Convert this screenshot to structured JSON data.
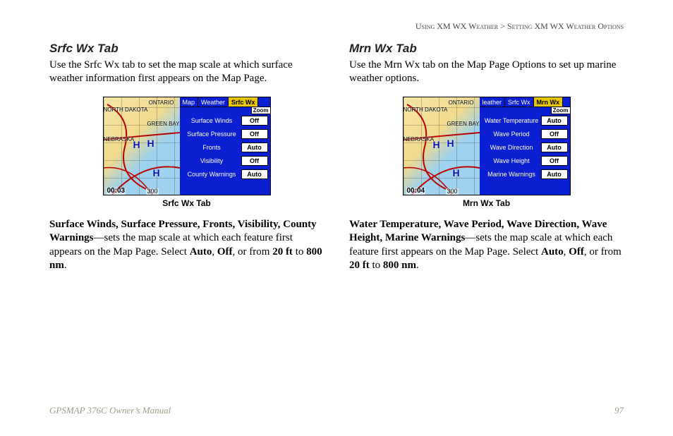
{
  "breadcrumb": {
    "section": "Using XM WX Weather",
    "sep": " > ",
    "sub": "Setting XM WX Weather Options"
  },
  "left": {
    "heading": "Srfc Wx Tab",
    "intro": "Use the Srfc Wx tab to set the map scale at which surface weather information first appears on the Map Page.",
    "device": {
      "tabs": [
        "Map",
        "Weather",
        "Srfc Wx"
      ],
      "activeTabIndex": 2,
      "zoomLabel": "Zoom",
      "rows": [
        {
          "label": "Surface Winds",
          "value": "Off"
        },
        {
          "label": "Surface Pressure",
          "value": "Off"
        },
        {
          "label": "Fronts",
          "value": "Auto"
        },
        {
          "label": "Visibility",
          "value": "Off"
        },
        {
          "label": "County Warnings",
          "value": "Auto"
        }
      ],
      "clock": "00:03",
      "scale": "300",
      "states": [
        "ONTARIO",
        "GREEN BAY",
        "NEBRASKA",
        "NORTH DAKOTA"
      ]
    },
    "caption": "Srfc Wx Tab",
    "desc": {
      "bold_list": "Surface Winds, Surface Pressure, Fronts, Visibility, County Warnings",
      "mid": "—sets the map scale at which each feature first appears on the Map Page. Select ",
      "opts": {
        "a": "Auto",
        "b": "Off",
        "c": "20 ft",
        "d": "800 nm"
      }
    }
  },
  "right": {
    "heading": "Mrn Wx Tab",
    "intro": "Use the Mrn Wx tab on the Map Page Options to set up marine weather options.",
    "device": {
      "tabs": [
        "leather",
        "Srfc Wx",
        "Mrn Wx"
      ],
      "activeTabIndex": 2,
      "zoomLabel": "Zoom",
      "rows": [
        {
          "label": "Water Temperature",
          "value": "Auto"
        },
        {
          "label": "Wave Period",
          "value": "Off"
        },
        {
          "label": "Wave Direction",
          "value": "Auto"
        },
        {
          "label": "Wave Height",
          "value": "Off"
        },
        {
          "label": "Marine Warnings",
          "value": "Auto"
        }
      ],
      "clock": "00:04",
      "scale": "300",
      "states": [
        "ONTARIO",
        "GREEN BAY",
        "NEBRASKA",
        "NORTH DAKOTA"
      ]
    },
    "caption": "Mrn Wx Tab",
    "desc": {
      "bold_list": "Water Temperature, Wave Period, Wave Direction, Wave Height, Marine Warnings",
      "mid": "—sets the map scale at which each feature first appears on the Map Page. Select ",
      "opts": {
        "a": "Auto",
        "b": "Off",
        "c": "20 ft",
        "d": "800 nm"
      }
    }
  },
  "footer": {
    "title": "GPSMAP 376C Owner’s Manual",
    "page": "97"
  }
}
